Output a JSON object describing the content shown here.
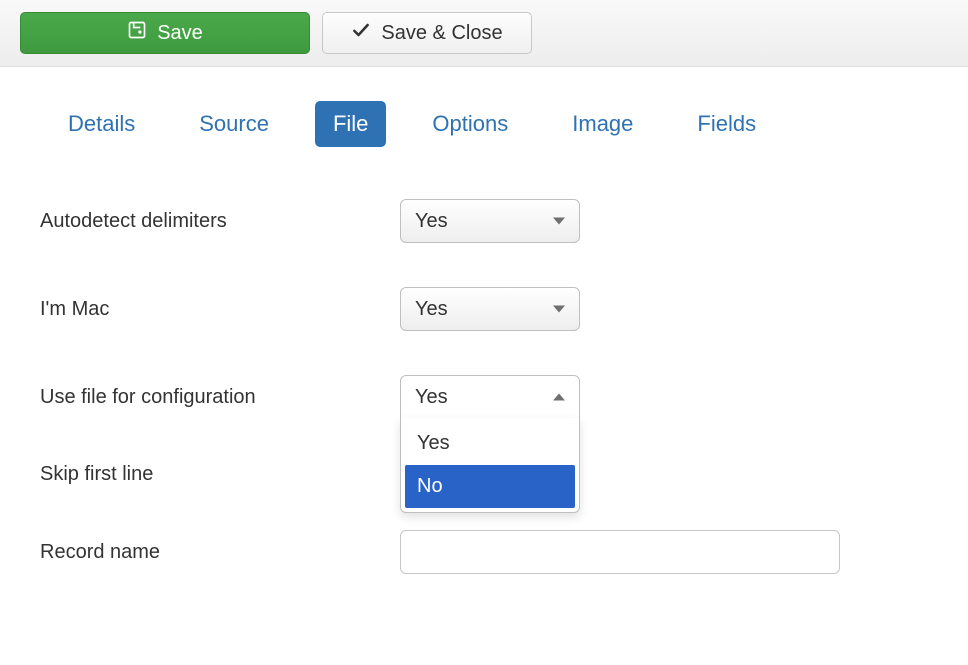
{
  "toolbar": {
    "save_label": "Save",
    "save_close_label": "Save & Close"
  },
  "tabs": {
    "details": "Details",
    "source": "Source",
    "file": "File",
    "options": "Options",
    "image": "Image",
    "fields": "Fields",
    "active": "file"
  },
  "form": {
    "autodetect": {
      "label": "Autodetect delimiters",
      "value": "Yes"
    },
    "im_mac": {
      "label": "I'm Mac",
      "value": "Yes"
    },
    "use_file_config": {
      "label": "Use file for configuration",
      "value": "Yes",
      "options": {
        "yes": "Yes",
        "no": "No"
      },
      "highlighted": "No"
    },
    "skip_first_line": {
      "label": "Skip first line"
    },
    "record_name": {
      "label": "Record name",
      "value": ""
    }
  }
}
